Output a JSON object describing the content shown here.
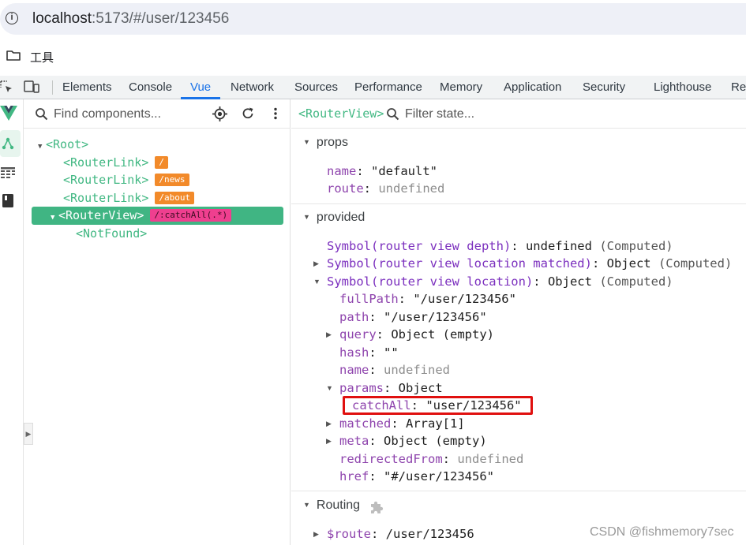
{
  "address_bar": {
    "url_host": "localhost",
    "url_rest": ":5173/#/user/123456"
  },
  "bookmarks": {
    "items": [
      {
        "label": "工具"
      }
    ]
  },
  "devtools": {
    "tabs": [
      "Elements",
      "Console",
      "Vue",
      "Network",
      "Sources",
      "Performance",
      "Memory",
      "Application",
      "Security",
      "Lighthouse",
      "Re"
    ],
    "active_tab": "Vue"
  },
  "component_tree": {
    "search_placeholder": "Find components...",
    "rows": [
      {
        "tag": "<Root>"
      },
      {
        "tag": "<RouterLink>",
        "badge": "/"
      },
      {
        "tag": "<RouterLink>",
        "badge": "/news"
      },
      {
        "tag": "<RouterLink>",
        "badge": "/about"
      },
      {
        "tag": "<RouterView>",
        "badge": "/:catchAll(.*)",
        "selected": true
      },
      {
        "tag": "<NotFound>"
      }
    ]
  },
  "state_panel": {
    "title": "<RouterView>",
    "filter_placeholder": "Filter state...",
    "props": {
      "header": "props",
      "items": [
        {
          "key": "name",
          "value": "\"default\""
        },
        {
          "key": "route",
          "value": "undefined"
        }
      ]
    },
    "provided": {
      "header": "provided",
      "items": [
        {
          "key": "Symbol(router view depth)",
          "value": "undefined",
          "note": "(Computed)"
        },
        {
          "key": "Symbol(router view location matched)",
          "value": "Object",
          "note": "(Computed)"
        },
        {
          "key": "Symbol(router view location)",
          "value": "Object",
          "note": "(Computed)"
        },
        {
          "key": "fullPath",
          "value": "\"/user/123456\""
        },
        {
          "key": "path",
          "value": "\"/user/123456\""
        },
        {
          "key": "query",
          "value": "Object (empty)"
        },
        {
          "key": "hash",
          "value": "\"\""
        },
        {
          "key": "name",
          "value": "undefined"
        },
        {
          "key": "params",
          "value": "Object"
        },
        {
          "key": "catchAll",
          "value": "\"user/123456\""
        },
        {
          "key": "matched",
          "value": "Array[1]"
        },
        {
          "key": "meta",
          "value": "Object (empty)"
        },
        {
          "key": "redirectedFrom",
          "value": "undefined"
        },
        {
          "key": "href",
          "value": "\"#/user/123456\""
        }
      ]
    },
    "routing": {
      "header": "Routing",
      "items": [
        {
          "key": "$route",
          "value": "/user/123456"
        }
      ]
    }
  },
  "watermark": "CSDN @fishmemory7sec",
  "colors": {
    "vue_green": "#42b883",
    "selected_row": "#40b583",
    "accent_blue": "#1a73e8",
    "highlight_red": "#e0100f",
    "key_purple": "#8e44ad"
  }
}
